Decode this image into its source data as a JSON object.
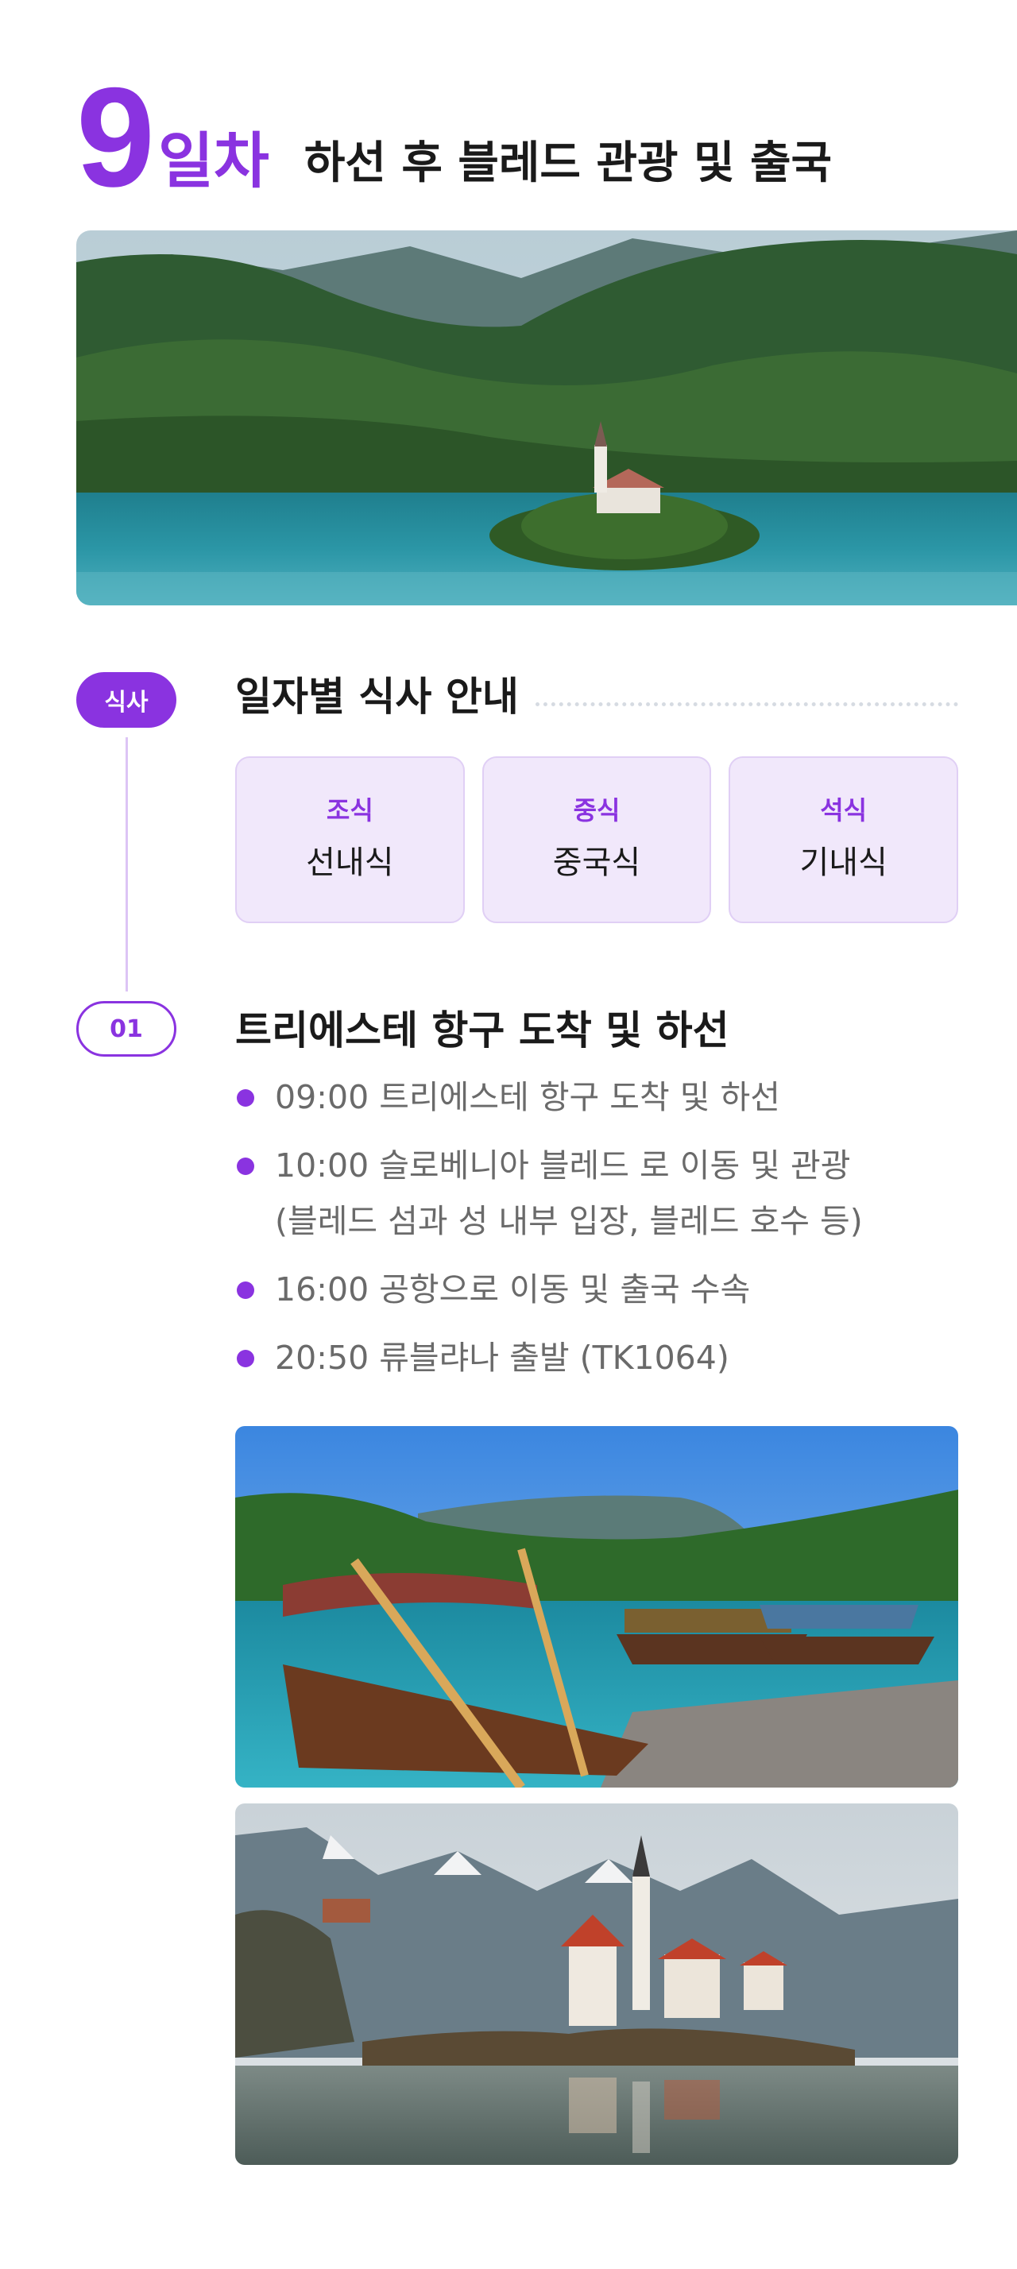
{
  "day": {
    "number": "9",
    "word": "일차",
    "title": "하선 후 블레드 관광 및 출국"
  },
  "meals": {
    "badge": "식사",
    "title": "일자별 식사 안내",
    "items": [
      {
        "label": "조식",
        "value": "선내식"
      },
      {
        "label": "중식",
        "value": "중국식"
      },
      {
        "label": "석식",
        "value": "기내식"
      }
    ]
  },
  "step": {
    "badge": "01",
    "title": "트리에스테 항구 도착 및 하선",
    "schedule": [
      {
        "text": "09:00 트리에스테 항구 도착 및 하선",
        "sub": ""
      },
      {
        "text": "10:00 슬로베니아 블레드 로 이동 및 관광",
        "sub": "(블레드 섬과 성 내부 입장, 블레드 호수 등)"
      },
      {
        "text": "16:00 공항으로 이동 및 출국 수속",
        "sub": ""
      },
      {
        "text": "20:50 류블랴나 출발 (TK1064)",
        "sub": ""
      }
    ]
  },
  "colors": {
    "accent": "#8a33e0",
    "card_bg": "#f1e8fb",
    "timeline": "#dcc4f5"
  }
}
